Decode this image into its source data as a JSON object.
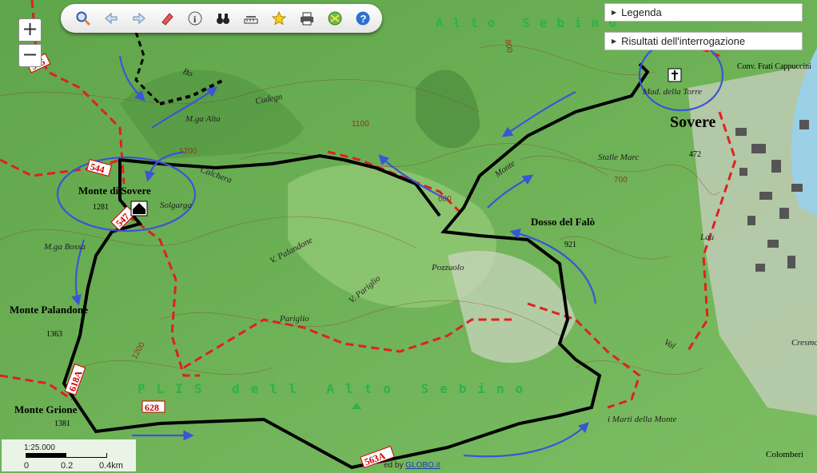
{
  "toolbar": {
    "buttons": [
      {
        "name": "zoom-search-icon"
      },
      {
        "name": "back-arrow-icon"
      },
      {
        "name": "forward-arrow-icon"
      },
      {
        "name": "eraser-icon"
      },
      {
        "name": "info-icon"
      },
      {
        "name": "binoculars-icon"
      },
      {
        "name": "measure-icon"
      },
      {
        "name": "star-icon"
      },
      {
        "name": "print-icon"
      },
      {
        "name": "layers-icon"
      },
      {
        "name": "help-icon"
      }
    ]
  },
  "zoom": {
    "in": "+",
    "out": "−"
  },
  "panels": {
    "legend": "Legenda",
    "results": "Risultati dell'interrogazione"
  },
  "scale": {
    "ratio": "1:25.000",
    "ticks": [
      "0",
      "0.2",
      "0.4km"
    ]
  },
  "credit": {
    "prefix": "ed by",
    "link": "GLOBO.it"
  },
  "map": {
    "peaks": [
      {
        "name": "Monte di Sovere",
        "elev": "1281"
      },
      {
        "name": "Monte Palandone",
        "elev": "1363"
      },
      {
        "name": "Monte Grione",
        "elev": "1381"
      },
      {
        "name": "Dosso del Falò",
        "elev": "921"
      }
    ],
    "town": "Sovere",
    "town_elev": "472",
    "park_label": "PLIS dell Alto Sebino",
    "region_label": "Alto Sebino",
    "places": [
      "M.ga Alta",
      "M.ga Bossa",
      "Pozzuolo",
      "Pariglio",
      "Stalle Marc",
      "Mad. della Torre",
      "Conv. Frati Cappuccini",
      "Cresmo",
      "Colomberi",
      "i Marti della Monte",
      "Lau",
      "Bo",
      "Calchera",
      "Cudegn",
      "Solgarga",
      "V. Palandone",
      "V. Pariglio",
      "Monte",
      "Val"
    ],
    "contours": [
      "1100",
      "1200",
      "1200",
      "800",
      "700",
      "600"
    ],
    "trails": [
      "545",
      "544",
      "547",
      "618A",
      "628",
      "563A"
    ],
    "colors": {
      "trail": "#e02020",
      "route": "#000000",
      "annotation": "#3b55d6",
      "park": "#2db14b",
      "contour": "#8a3a1c"
    }
  }
}
